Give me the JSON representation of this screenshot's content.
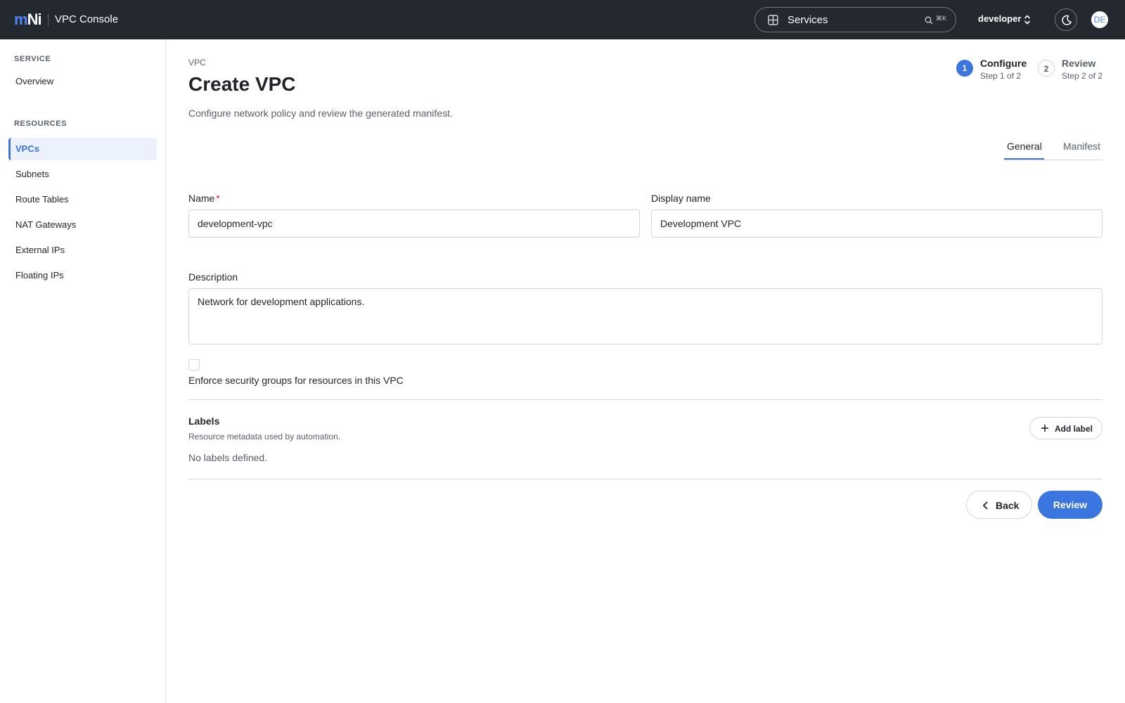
{
  "header": {
    "logo_m": "m",
    "logo_ni": "Ni",
    "app_title": "VPC Console",
    "search_label": "Services",
    "search_shortcut": "⌘K",
    "project": "developer",
    "avatar_initials": "DE"
  },
  "sidebar": {
    "sections": [
      {
        "heading": "SERVICE",
        "items": [
          {
            "label": "Overview"
          }
        ]
      },
      {
        "heading": "RESOURCES",
        "items": [
          {
            "label": "VPCs",
            "active": true
          },
          {
            "label": "Subnets"
          },
          {
            "label": "Route Tables"
          },
          {
            "label": "NAT Gateways"
          },
          {
            "label": "External IPs"
          },
          {
            "label": "Floating IPs"
          }
        ]
      }
    ]
  },
  "main": {
    "breadcrumb": "VPC",
    "title": "Create VPC",
    "subtitle": "Configure network policy and review the generated manifest.",
    "steps": [
      {
        "number": "1",
        "title": "Configure",
        "sub": "Step 1 of 2",
        "active": true
      },
      {
        "number": "2",
        "title": "Review",
        "sub": "Step 2 of 2",
        "active": false
      }
    ],
    "tabs": [
      {
        "label": "General",
        "active": true
      },
      {
        "label": "Manifest",
        "active": false
      }
    ],
    "form": {
      "name_label": "Name",
      "required_mark": "*",
      "name_value": "development-vpc",
      "display_name_label": "Display name",
      "display_name_value": "Development VPC",
      "description_label": "Description",
      "description_value": "Network for development applications.",
      "enforce_sg_label": "Enforce security groups for resources in this VPC",
      "enforce_sg_checked": false
    },
    "labels": {
      "title": "Labels",
      "subtitle": "Resource metadata used by automation.",
      "empty": "No labels defined.",
      "add_button": "Add label"
    },
    "actions": {
      "back": "Back",
      "review": "Review"
    }
  },
  "colors": {
    "topbar": "#24292f",
    "accent": "#3b76e0",
    "required": "#cf222e"
  }
}
